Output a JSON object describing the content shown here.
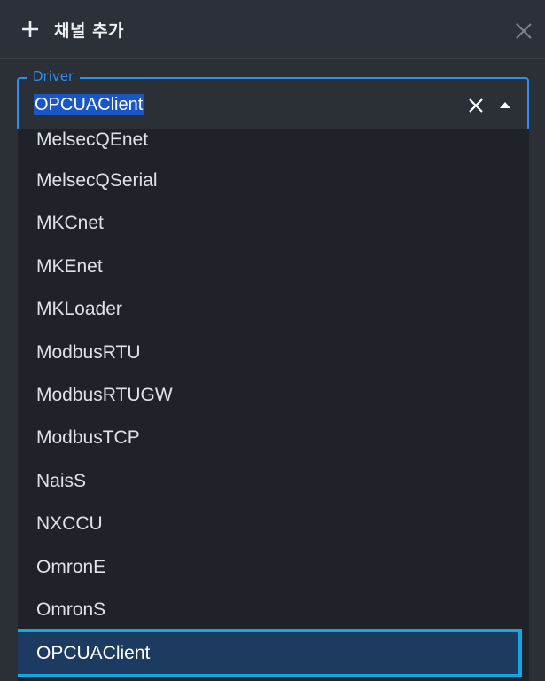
{
  "dialog": {
    "title": "채널 추가"
  },
  "driver_field": {
    "legend": "Driver",
    "value": "OPCUAClient"
  },
  "dropdown": {
    "options": [
      "MelsecQEnet",
      "MelsecQSerial",
      "MKCnet",
      "MKEnet",
      "MKLoader",
      "ModbusRTU",
      "ModbusRTUGW",
      "ModbusTCP",
      "NaisS",
      "NXCCU",
      "OmronE",
      "OmronS",
      "OPCUAClient"
    ],
    "selected": "OPCUAClient"
  },
  "colors": {
    "accent": "#2f8df5",
    "selection_outline": "#14a7e6",
    "selection_fill": "#1d3a61",
    "text_highlight": "#1a56c8"
  },
  "icons": {
    "title": "plus-icon",
    "close": "close-icon",
    "clear": "clear-icon",
    "toggle": "caret-up-icon"
  }
}
